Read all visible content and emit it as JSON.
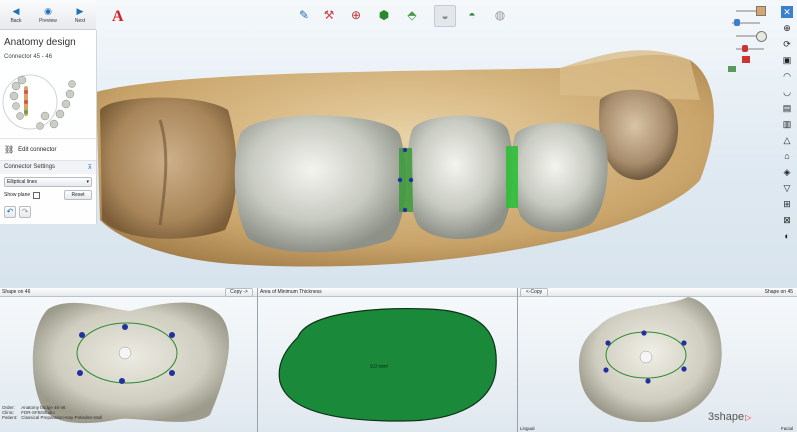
{
  "nav": {
    "back": "Back",
    "preview": "Preview",
    "next": "Next"
  },
  "panel": {
    "title": "Anatomy design",
    "connector_label": "Connector 45 - 46",
    "edit_connector": "Edit connector",
    "connector_settings": "Connector Settings",
    "shape_option": "Elliptical lines",
    "show_plane": "Show plane",
    "reset": "Reset"
  },
  "toolbar": {
    "brand_mark": "A"
  },
  "bottom": {
    "left_title": "Shape on 46",
    "left_copy": "Copy ->",
    "info_lines": [
      "Order:",
      "Clinic:",
      "Patient:"
    ],
    "info_values": [
      "Anatomy bridge 46-46",
      "FDR-SFB/Studio",
      "Classical Preparation-Nay-Potieden-Moll"
    ],
    "center_title": "Area of Minimum Thickness",
    "thickness_value": "9.0 mm²",
    "right_copy": "<-Copy",
    "right_title": "Shape on 45",
    "lingual": "Lingual",
    "facial": "Facial",
    "logo": "3shape"
  },
  "colors": {
    "accent": "#1f6fb8",
    "connector_green": "#1a8a3a",
    "control_point": "#2430a0"
  }
}
